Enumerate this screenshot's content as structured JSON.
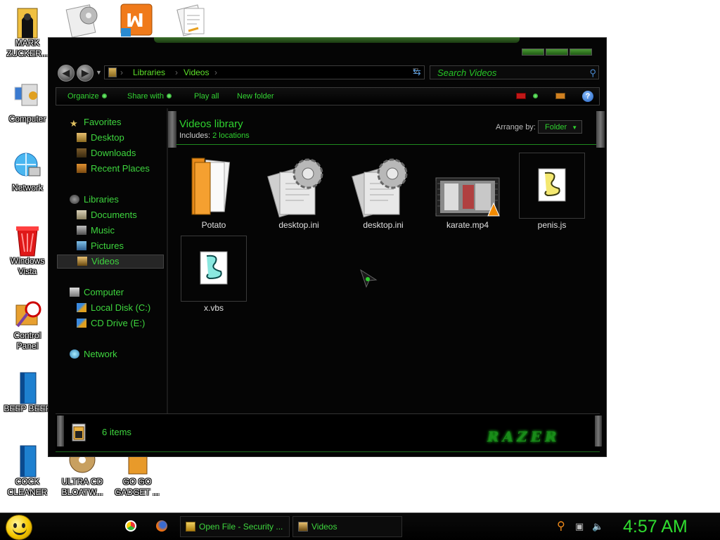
{
  "desktop": {
    "icons": [
      {
        "label": "MARK ZUCKER..."
      },
      {
        "label": "Computer"
      },
      {
        "label": "Network"
      },
      {
        "label": "Windows Vista"
      },
      {
        "label": "Control Panel"
      },
      {
        "label": "BEEP BEEP"
      },
      {
        "label": "COCK CLEANER"
      },
      {
        "label": "ULTRA CD BLOATW..."
      },
      {
        "label": "GO GO GADGET ..."
      }
    ]
  },
  "window": {
    "address": {
      "crumbs": [
        "Libraries",
        "Videos"
      ]
    },
    "search": {
      "placeholder": "Search Videos"
    },
    "toolbar": {
      "organize": "Organize",
      "share_with": "Share with",
      "play_all": "Play all",
      "new_folder": "New folder",
      "help": "?"
    },
    "nav": {
      "favorites": "Favorites",
      "desktop": "Desktop",
      "downloads": "Downloads",
      "recent_places": "Recent Places",
      "libraries": "Libraries",
      "documents": "Documents",
      "music": "Music",
      "pictures": "Pictures",
      "videos": "Videos",
      "computer": "Computer",
      "local_disk": "Local Disk (C:)",
      "cd_drive": "CD Drive (E:)",
      "network": "Network"
    },
    "library": {
      "title": "Videos library",
      "includes_label": "Includes:",
      "includes_link": "2 locations",
      "arrange_label": "Arrange by:",
      "arrange_value": "Folder"
    },
    "files": [
      {
        "name": "Potato",
        "type": "folder"
      },
      {
        "name": "desktop.ini",
        "type": "settings"
      },
      {
        "name": "desktop.ini",
        "type": "settings"
      },
      {
        "name": "karate.mp4",
        "type": "video"
      },
      {
        "name": "penis.js",
        "type": "script"
      },
      {
        "name": "x.vbs",
        "type": "script"
      }
    ],
    "status": {
      "count": "6 items",
      "brand": "RAZER"
    }
  },
  "taskbar": {
    "tasks": [
      {
        "label": "Open File - Security ..."
      },
      {
        "label": "Videos"
      }
    ],
    "clock": "4:57 AM"
  },
  "colors": {
    "accent_green": "#3ed63e",
    "window_bg": "#050505",
    "clock_green": "#2fdc2f"
  }
}
